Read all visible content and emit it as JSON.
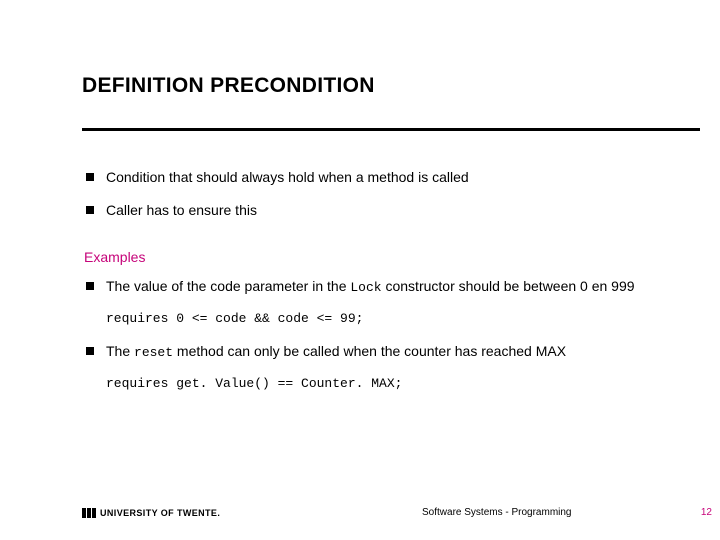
{
  "title": "DEFINITION PRECONDITION",
  "bullets": {
    "b1": "Condition that should always hold when a method is called",
    "b2": "Caller has to ensure this"
  },
  "examples_label": "Examples",
  "ex1": {
    "pre": "The value of the code parameter in the ",
    "code": "Lock",
    "post": " constructor should be between 0 en 999"
  },
  "ex1_code": "requires 0 <= code && code <= 99;",
  "ex2": {
    "pre": "The ",
    "code": "reset",
    "post": " method can only be called when the counter has reached MAX"
  },
  "ex2_code": "requires get. Value() == Counter. MAX;",
  "footer": {
    "logo_text": "UNIVERSITY OF TWENTE.",
    "center": "Software Systems - Programming",
    "page": "12"
  }
}
